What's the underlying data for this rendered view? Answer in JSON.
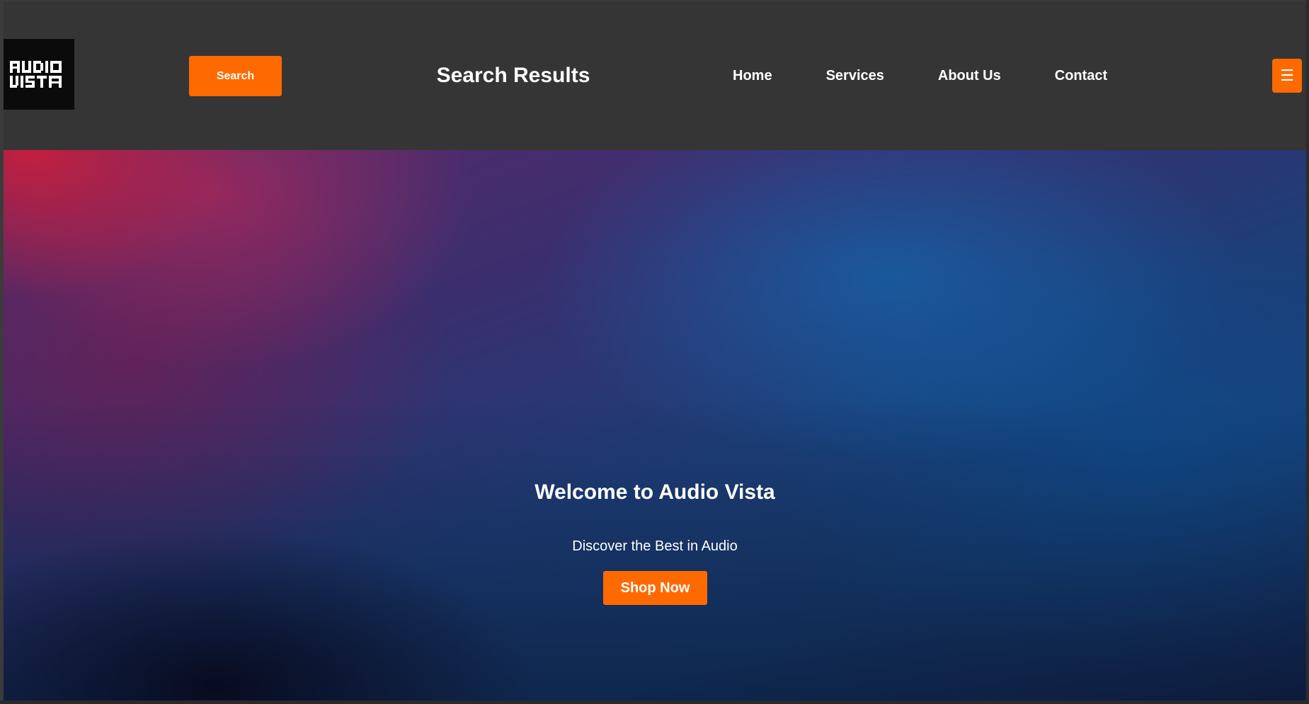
{
  "header": {
    "logo": {
      "text_line1": "AUDIO",
      "text_line2": "VISTA",
      "bg_color": "#0b0b0b"
    },
    "search_label": "Search",
    "page_title": "Search Results",
    "nav": [
      {
        "label": "Home"
      },
      {
        "label": "Services"
      },
      {
        "label": "About Us"
      },
      {
        "label": "Contact"
      }
    ],
    "menu_icon": "hamburger-menu-icon",
    "menu_glyph": "☰"
  },
  "hero": {
    "title": "Welcome to Audio Vista",
    "subtitle": "Discover the Best in Audio",
    "cta_label": "Shop Now"
  },
  "colors": {
    "accent": "#ff6a00",
    "header_bg": "#353535",
    "text": "#ffffff"
  }
}
